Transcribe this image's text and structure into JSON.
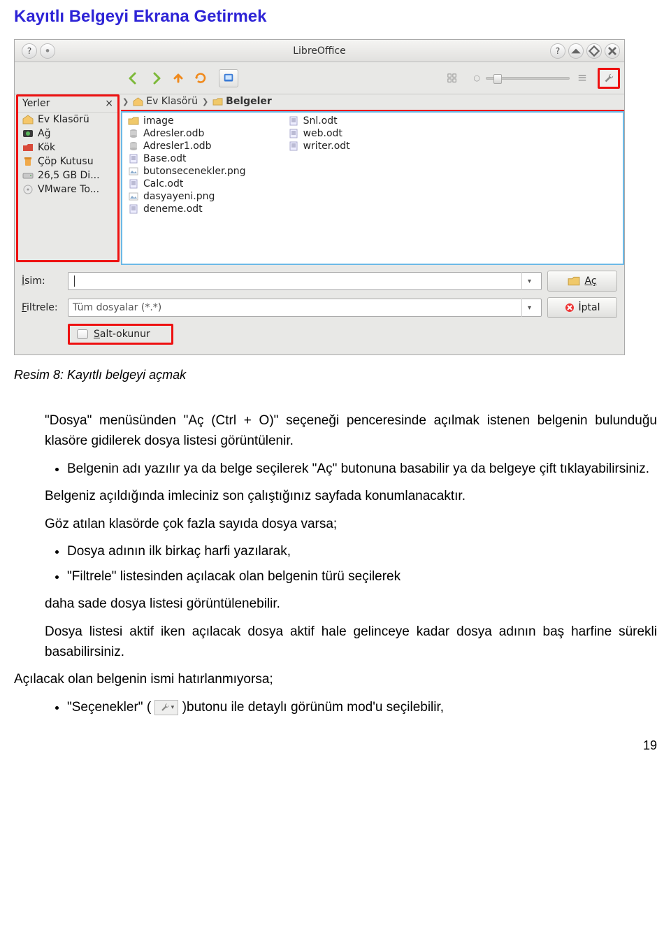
{
  "heading": "Kayıtlı Belgeyi Ekrana Getirmek",
  "dialog": {
    "title": "LibreOffice",
    "places_header": "Yerler",
    "places": [
      {
        "icon": "home",
        "label": "Ev Klasörü"
      },
      {
        "icon": "net",
        "label": "Ağ"
      },
      {
        "icon": "root",
        "label": "Kök"
      },
      {
        "icon": "trash",
        "label": "Çöp Kutusu"
      },
      {
        "icon": "disk",
        "label": "26,5 GB Di..."
      },
      {
        "icon": "cd",
        "label": "VMware To..."
      }
    ],
    "breadcrumb": [
      "Ev Klasörü",
      "Belgeler"
    ],
    "files_col1": [
      {
        "icon": "folder",
        "label": "image"
      },
      {
        "icon": "db",
        "label": "Adresler.odb"
      },
      {
        "icon": "db",
        "label": "Adresler1.odb"
      },
      {
        "icon": "doc",
        "label": "Base.odt"
      },
      {
        "icon": "img",
        "label": "butonsecenekler.png"
      },
      {
        "icon": "doc",
        "label": "Calc.odt"
      },
      {
        "icon": "img",
        "label": "dasyayeni.png"
      },
      {
        "icon": "doc",
        "label": "deneme.odt"
      }
    ],
    "files_col2": [
      {
        "icon": "doc",
        "label": "Snl.odt"
      },
      {
        "icon": "doc",
        "label": "web.odt"
      },
      {
        "icon": "doc",
        "label": "writer.odt"
      }
    ],
    "name_label": "İsim:",
    "name_value": "",
    "filter_label": "Filtrele:",
    "filter_value": "Tüm dosyalar (*.*)",
    "btn_open": "Aç",
    "btn_cancel": "İptal",
    "readonly_label": "Salt-okunur"
  },
  "caption": "Resim 8: Kayıtlı belgeyi açmak",
  "para1": "\"Dosya\" menüsünden \"Aç (Ctrl + O)\" seçeneği penceresinde açılmak istenen belgenin bulunduğu klasöre gidilerek dosya listesi görüntülenir.",
  "bullets1": [
    "Belgenin adı yazılır ya da belge seçilerek \"Aç\" butonuna basabilir ya da belgeye çift tıklayabilirsiniz."
  ],
  "para2": "Belgeniz açıldığında imleciniz son çalıştığınız sayfada konumlanacaktır.",
  "para3": "Göz atılan klasörde çok fazla sayıda dosya varsa;",
  "bullets2": [
    "Dosya adının ilk birkaç harfi yazılarak,",
    "\"Filtrele\" listesinden açılacak olan belgenin türü seçilerek"
  ],
  "para4": "daha sade dosya listesi görüntülenebilir.",
  "para5": "Dosya listesi aktif iken açılacak dosya aktif hale gelinceye kadar dosya adının baş harfine sürekli basabilirsiniz.",
  "para6": "Açılacak olan belgenin ismi hatırlanmıyorsa;",
  "bullet_last_pre": "\"Seçenekler\" (",
  "bullet_last_post": ")butonu ile detaylı görünüm mod'u seçilebilir,",
  "page_number": "19"
}
